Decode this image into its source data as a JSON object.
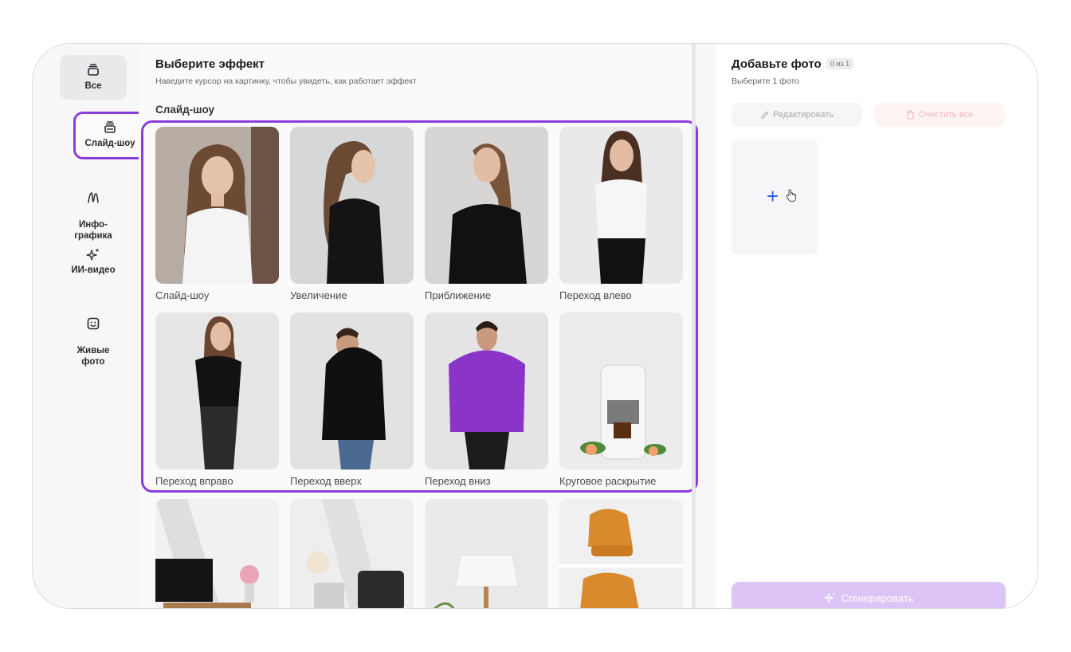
{
  "sidebar": {
    "items": [
      {
        "label": "Все",
        "icon": "stack-icon"
      },
      {
        "label": "Слайд-шоу",
        "icon": "slideshow-icon"
      },
      {
        "label": "Инфо-\nграфика",
        "icon": "infographic-icon"
      },
      {
        "label": "ИИ-видео",
        "icon": "sparkle-icon"
      },
      {
        "label": "Живые\nфото",
        "icon": "smiley-icon"
      }
    ]
  },
  "effects": {
    "title": "Выберите эффект",
    "subtitle": "Наведите курсор на картинку, чтобы увидеть, как работает эффект",
    "section": "Слайд-шоу",
    "cards": [
      {
        "label": "Слайд-шоу"
      },
      {
        "label": "Увеличение"
      },
      {
        "label": "Приближение"
      },
      {
        "label": "Переход влево"
      },
      {
        "label": "Переход вправо"
      },
      {
        "label": "Переход вверх"
      },
      {
        "label": "Переход вниз"
      },
      {
        "label": "Круговое раскрытие"
      }
    ]
  },
  "upload": {
    "title": "Добавьте фото",
    "count": "0 из 1",
    "subtitle": "Выберите 1 фото",
    "edit_label": "Редактировать",
    "clear_label": "Очистить все",
    "add_symbol": "+",
    "generate_label": "Сгенерировать"
  },
  "colors": {
    "accent": "#8b3ddb",
    "plus": "#2e63d6",
    "generate_bg": "#dcc4f7"
  }
}
